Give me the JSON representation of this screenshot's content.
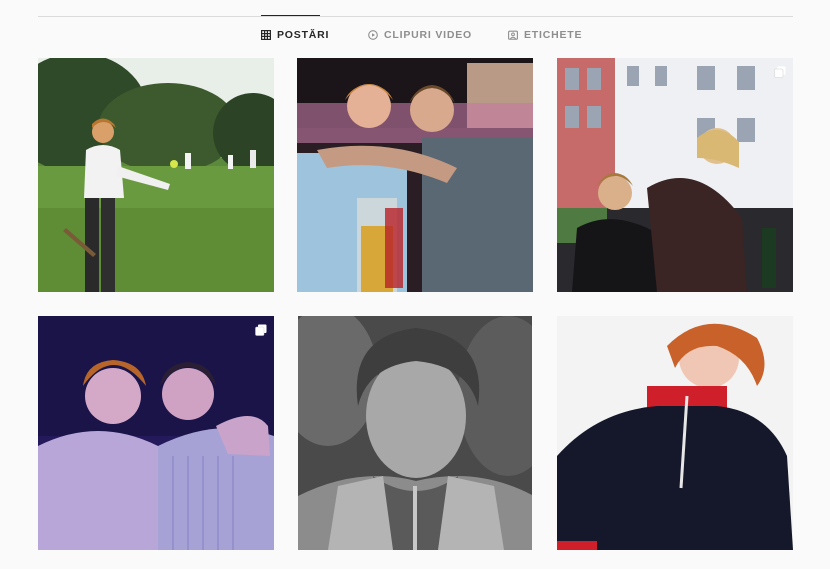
{
  "tabs": [
    {
      "label": "POSTĂRI",
      "icon": "grid-icon",
      "active": true
    },
    {
      "label": "CLIPURI VIDEO",
      "icon": "play-circle-icon",
      "active": false
    },
    {
      "label": "ETICHETE",
      "icon": "tag-person-icon",
      "active": false
    }
  ],
  "posts": [
    {
      "scene": "outdoor-field-smoking",
      "multiple": false
    },
    {
      "scene": "party-friends-beer",
      "multiple": false
    },
    {
      "scene": "street-group-sitting",
      "multiple": true
    },
    {
      "scene": "purple-light-duo",
      "multiple": true
    },
    {
      "scene": "bw-portrait-curly",
      "multiple": false
    },
    {
      "scene": "studio-red-collar-jacket",
      "multiple": false
    }
  ],
  "colors": {
    "active": "#262626",
    "inactive": "#8e8e8e",
    "divider": "#dbdbdb",
    "bg": "#fafafa"
  }
}
